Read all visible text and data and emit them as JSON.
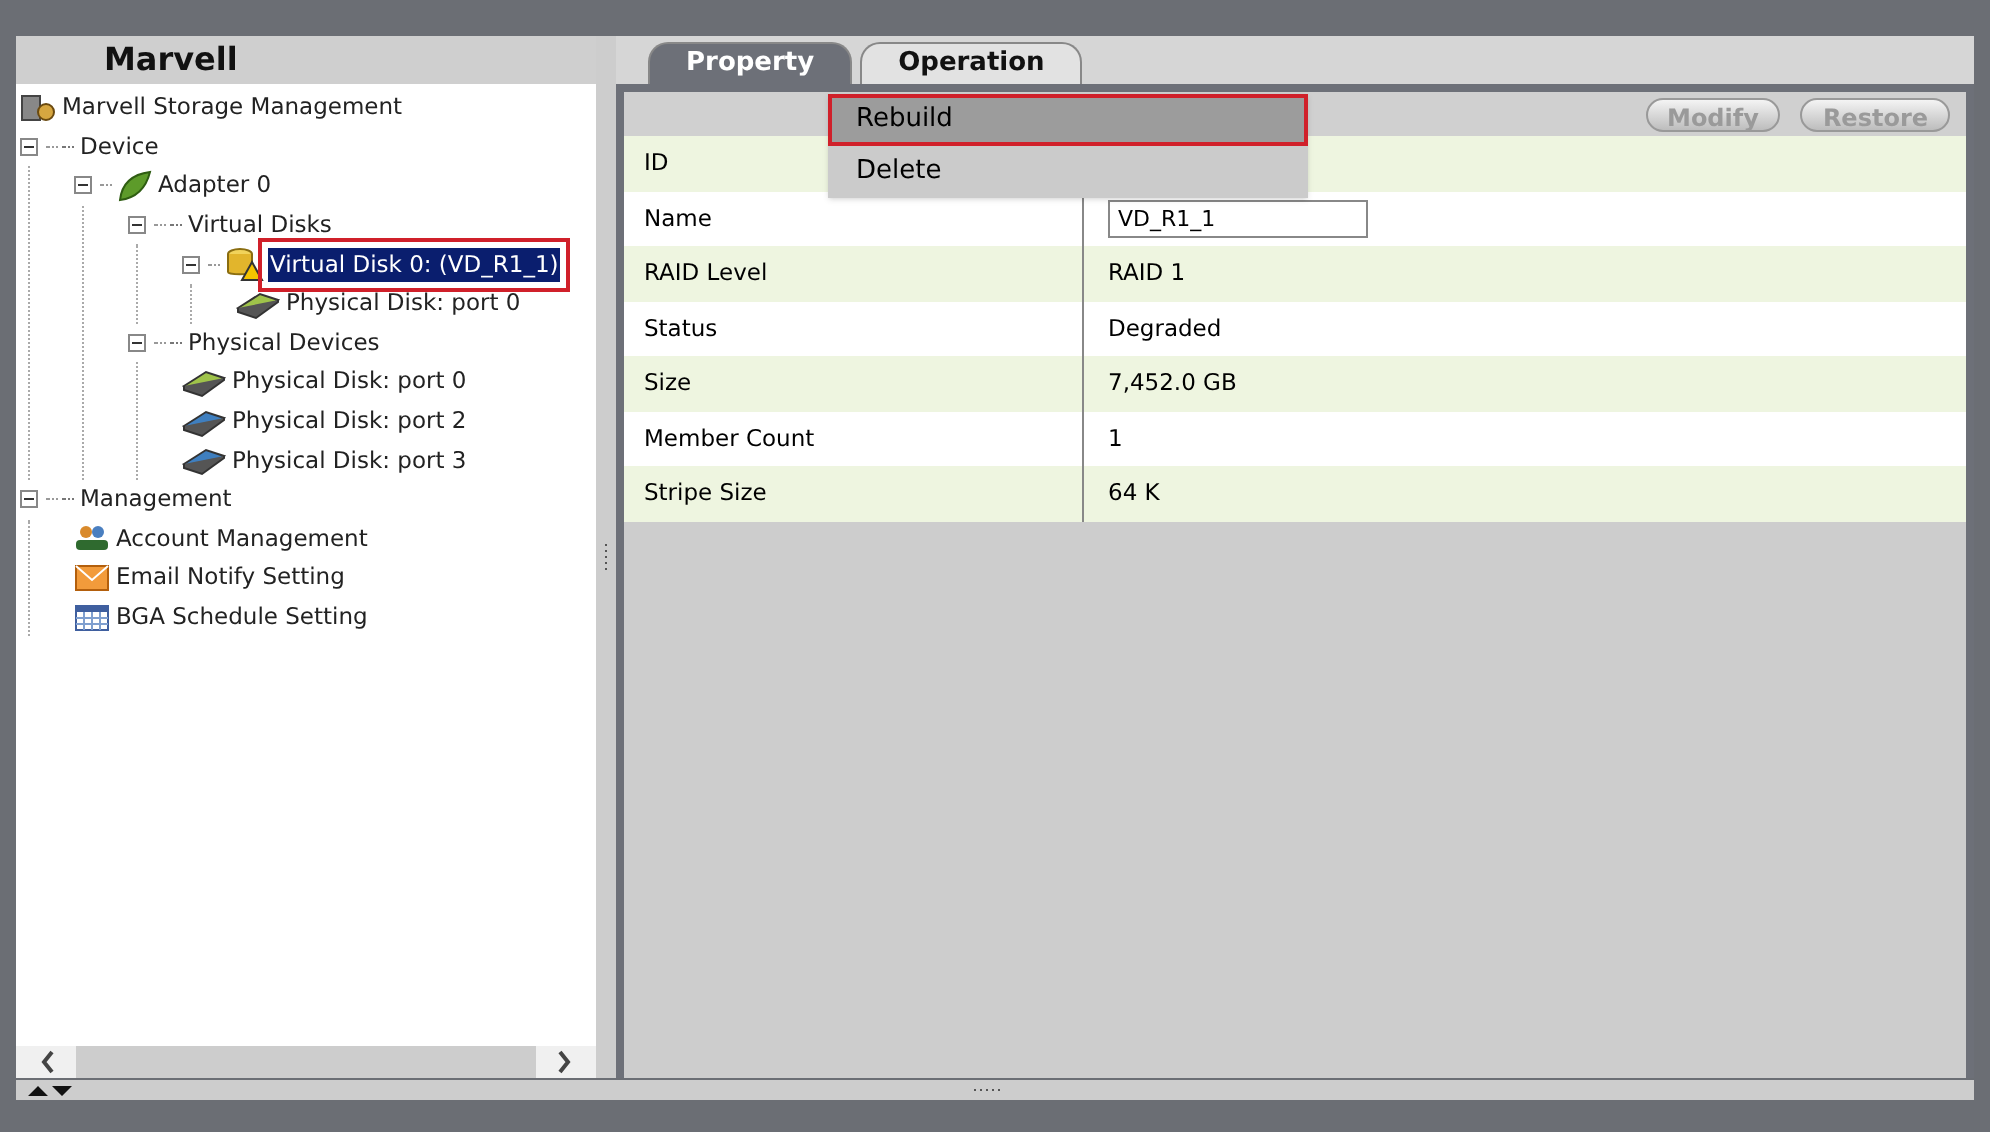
{
  "left_panel": {
    "title": "Marvell"
  },
  "tree": [
    {
      "label": "Marvell Storage Management",
      "kind": "storage",
      "selected": false,
      "outlined": false
    },
    {
      "label": "Device",
      "kind": "group",
      "expanded": true,
      "selected": false,
      "outlined": false,
      "children": [
        {
          "label": "Adapter 0",
          "kind": "adapter",
          "expanded": true,
          "selected": false,
          "outlined": false,
          "children": [
            {
              "label": "Virtual Disks",
              "kind": "group",
              "expanded": true,
              "selected": false,
              "outlined": false,
              "children": [
                {
                  "label": "Virtual Disk 0: (VD_R1_1)",
                  "kind": "vdisk",
                  "expanded": true,
                  "selected": true,
                  "outlined": true,
                  "children": [
                    {
                      "label": "Physical Disk: port 0",
                      "kind": "disk-green",
                      "selected": false,
                      "outlined": false
                    }
                  ]
                }
              ]
            },
            {
              "label": "Physical Devices",
              "kind": "group",
              "expanded": true,
              "selected": false,
              "outlined": false,
              "children": [
                {
                  "label": "Physical Disk: port 0",
                  "kind": "disk-green",
                  "selected": false,
                  "outlined": false
                },
                {
                  "label": "Physical Disk: port 2",
                  "kind": "disk-blue",
                  "selected": false,
                  "outlined": false
                },
                {
                  "label": "Physical Disk: port 3",
                  "kind": "disk-blue",
                  "selected": false,
                  "outlined": false
                }
              ]
            }
          ]
        }
      ]
    },
    {
      "label": "Management",
      "kind": "group",
      "expanded": true,
      "selected": false,
      "outlined": false,
      "children": [
        {
          "label": "Account Management",
          "kind": "people",
          "selected": false,
          "outlined": false
        },
        {
          "label": "Email Notify Setting",
          "kind": "email",
          "selected": false,
          "outlined": false
        },
        {
          "label": "BGA Schedule Setting",
          "kind": "calendar",
          "selected": false,
          "outlined": false
        }
      ]
    }
  ],
  "tabs": [
    {
      "label": "Property",
      "selected": true
    },
    {
      "label": "Operation",
      "selected": false
    }
  ],
  "operation_menu": [
    {
      "label": "Rebuild",
      "selected": true,
      "outlined": true
    },
    {
      "label": "Delete",
      "selected": false,
      "outlined": false
    }
  ],
  "toolbar_buttons": [
    {
      "label": "Modify",
      "disabled": true
    },
    {
      "label": "Restore",
      "disabled": true
    }
  ],
  "properties": [
    {
      "label": "ID",
      "kind": "text"
    },
    {
      "label": "Name",
      "kind": "input",
      "value": "VD_R1_1"
    },
    {
      "label": "RAID Level",
      "kind": "text",
      "value": "RAID 1"
    },
    {
      "label": "Status",
      "kind": "text",
      "value": "Degraded"
    },
    {
      "label": "Size",
      "kind": "text",
      "value": "7,452.0 GB"
    },
    {
      "label": "Member Count",
      "kind": "text",
      "value": "1"
    },
    {
      "label": "Stripe Size",
      "kind": "text",
      "value": "64 K"
    }
  ]
}
